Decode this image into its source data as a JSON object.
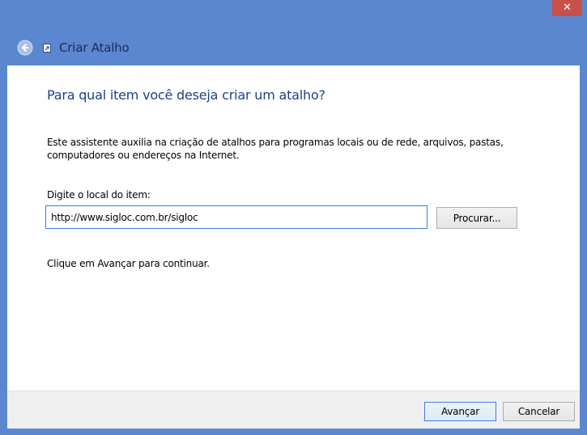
{
  "window": {
    "close_glyph": "✕",
    "accent_color": "#5b87d1",
    "close_color": "#c7504a"
  },
  "header": {
    "back_icon": "back-arrow-icon",
    "app_icon": "shortcut-icon",
    "title": "Criar Atalho"
  },
  "main": {
    "heading": "Para qual item você deseja criar um atalho?",
    "description": "Este assistente auxilia na criação de atalhos para programas locais ou de rede, arquivos, pastas, computadores ou endereços na Internet.",
    "field_label": "Digite o local do item:",
    "location_value": "http://www.sigloc.com.br/sigloc",
    "browse_label": "Procurar...",
    "hint": "Clique em Avançar para continuar."
  },
  "footer": {
    "next_label": "Avançar",
    "cancel_label": "Cancelar"
  }
}
